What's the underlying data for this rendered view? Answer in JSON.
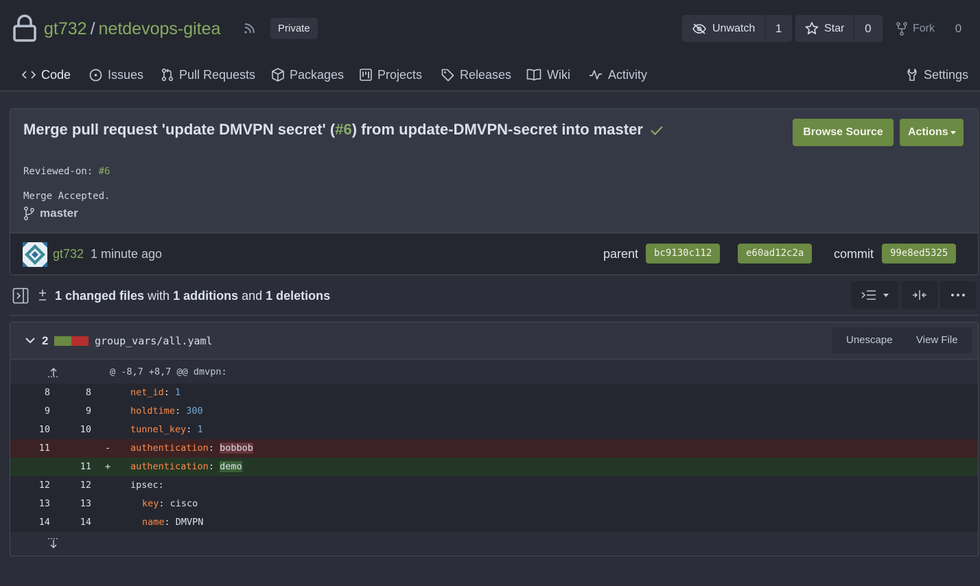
{
  "repo": {
    "owner": "gt732",
    "separator": "/",
    "name": "netdevops-gitea",
    "visibility": "Private",
    "watch": {
      "label": "Unwatch",
      "count": "1"
    },
    "star": {
      "label": "Star",
      "count": "0"
    },
    "fork": {
      "label": "Fork",
      "count": "0"
    }
  },
  "nav": {
    "code": "Code",
    "issues": "Issues",
    "pulls": "Pull Requests",
    "packages": "Packages",
    "projects": "Projects",
    "releases": "Releases",
    "wiki": "Wiki",
    "activity": "Activity",
    "settings": "Settings"
  },
  "commit": {
    "title_pre": "Merge pull request 'update DMVPN secret' (",
    "title_pr": "#6",
    "title_post": ") from update-DMVPN-secret into master",
    "reviewed_label": "Reviewed-on: ",
    "reviewed_link": "#6",
    "body": "Merge Accepted.",
    "branch": "master",
    "browse_label": "Browse Source",
    "actions_label": "Actions",
    "author": "gt732",
    "time": "1 minute ago",
    "parent_label": "parent",
    "parent_sha1": "bc9130c112",
    "parent_sha2": "e60ad12c2a",
    "commit_label": "commit",
    "commit_sha": "99e8ed5325"
  },
  "diff_summary": {
    "changed": "1 changed files",
    "with": " with ",
    "additions": "1 additions",
    "and": " and ",
    "deletions": "1 deletions"
  },
  "file": {
    "change_count": "2",
    "name": "group_vars/all.yaml",
    "unescape_label": "Unescape",
    "view_label": "View File",
    "hunk": "@ -8,7 +8,7 @@ dmvpn:"
  },
  "lines": {
    "l8": {
      "old": "8",
      "new": "8",
      "key": "net_id",
      "sep": ": ",
      "val": "1"
    },
    "l9": {
      "old": "9",
      "new": "9",
      "key": "holdtime",
      "sep": ": ",
      "val": "300"
    },
    "l10": {
      "old": "10",
      "new": "10",
      "key": "tunnel_key",
      "sep": ": ",
      "val": "1"
    },
    "ldel": {
      "old": "11",
      "sign": "-",
      "key": "authentication",
      "sep": ": ",
      "val": "bobbob"
    },
    "ladd": {
      "new": "11",
      "sign": "+",
      "key": "authentication",
      "sep": ": ",
      "val": "demo"
    },
    "l12": {
      "old": "12",
      "new": "12",
      "text": "ipsec:"
    },
    "l13": {
      "old": "13",
      "new": "13",
      "key": "key",
      "sep": ": ",
      "val": "cisco"
    },
    "l14": {
      "old": "14",
      "new": "14",
      "key": "name",
      "sep": ": ",
      "val": "DMVPN"
    }
  }
}
